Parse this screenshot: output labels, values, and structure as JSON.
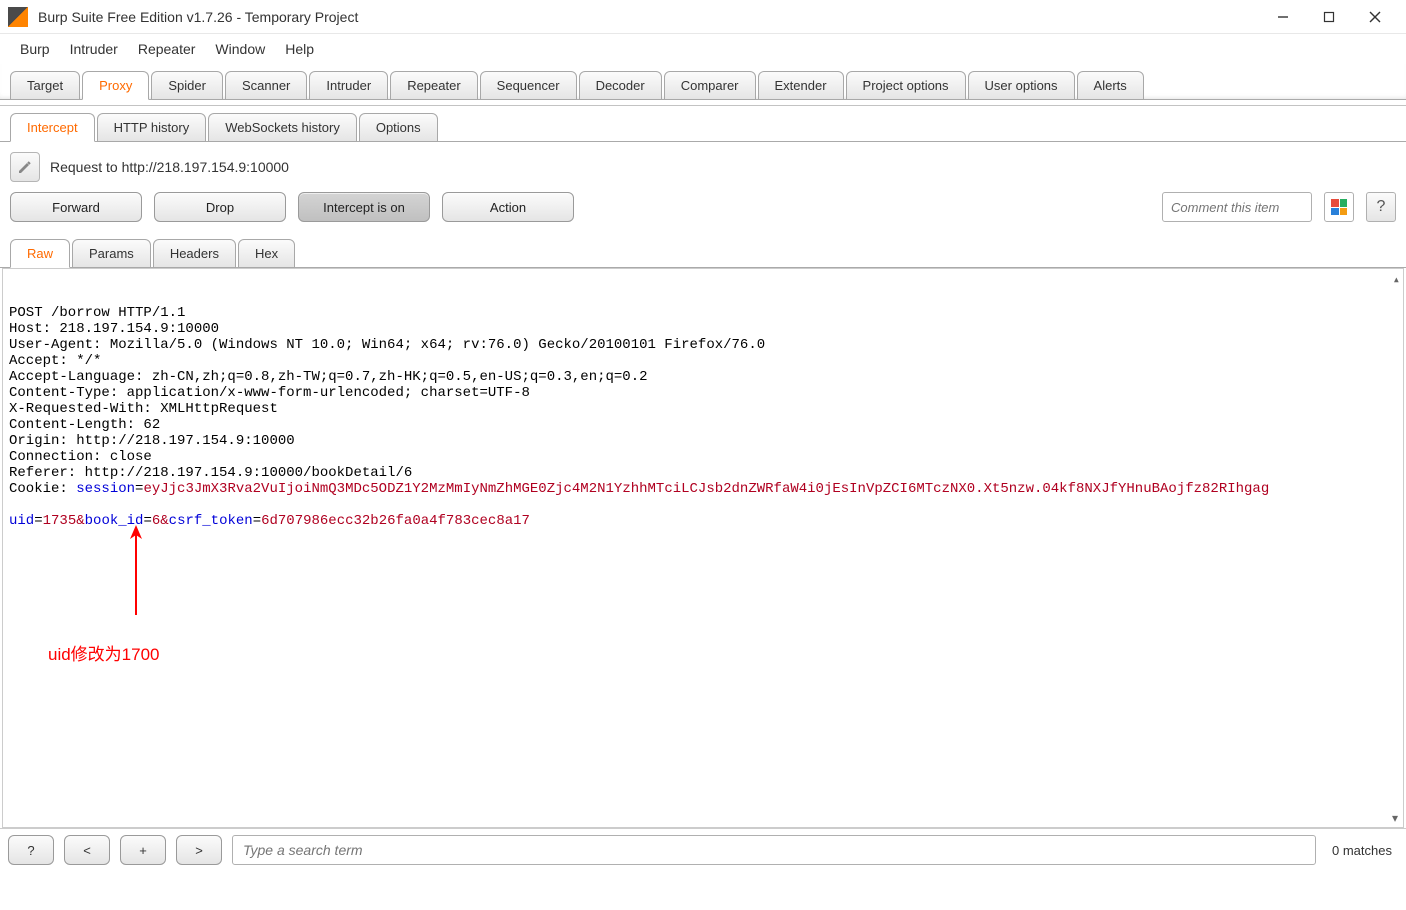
{
  "window": {
    "title": "Burp Suite Free Edition v1.7.26 - Temporary Project"
  },
  "menu": {
    "items": [
      "Burp",
      "Intruder",
      "Repeater",
      "Window",
      "Help"
    ]
  },
  "main_tabs": [
    "Target",
    "Proxy",
    "Spider",
    "Scanner",
    "Intruder",
    "Repeater",
    "Sequencer",
    "Decoder",
    "Comparer",
    "Extender",
    "Project options",
    "User options",
    "Alerts"
  ],
  "main_tab_active": 1,
  "sub_tabs": [
    "Intercept",
    "HTTP history",
    "WebSockets history",
    "Options"
  ],
  "sub_tab_active": 0,
  "request_label": "Request to http://218.197.154.9:10000",
  "buttons": {
    "forward": "Forward",
    "drop": "Drop",
    "intercept": "Intercept is on",
    "action": "Action"
  },
  "comment_placeholder": "Comment this item",
  "editor_tabs": [
    "Raw",
    "Params",
    "Headers",
    "Hex"
  ],
  "editor_tab_active": 0,
  "http": {
    "request_line": "POST /borrow HTTP/1.1",
    "headers": {
      "Host": "218.197.154.9:10000",
      "User-Agent": "Mozilla/5.0 (Windows NT 10.0; Win64; x64; rv:76.0) Gecko/20100101 Firefox/76.0",
      "Accept": "*/*",
      "Accept-Language": "zh-CN,zh;q=0.8,zh-TW;q=0.7,zh-HK;q=0.5,en-US;q=0.3,en;q=0.2",
      "Content-Type": "application/x-www-form-urlencoded; charset=UTF-8",
      "X-Requested-With": "XMLHttpRequest",
      "Content-Length": "62",
      "Origin": "http://218.197.154.9:10000",
      "Connection": "close",
      "Referer": "http://218.197.154.9:10000/bookDetail/6"
    },
    "cookie": {
      "name": "session",
      "value": "eyJjc3JmX3Rva2VuIjoiNmQ3MDc5ODZ1Y2MzMmIyNmZhMGE0Zjc4M2N1YzhhMTciLCJsb2dnZWRfaW4i0jEsInVpZCI6MTczNX0.Xt5nzw.04kf8NXJfYHnuBAojfz82RIhgag"
    },
    "body": [
      {
        "key": "uid",
        "value": "1735"
      },
      {
        "key": "book_id",
        "value": "6"
      },
      {
        "key": "csrf_token",
        "value": "6d707986ecc32b26fa0a4f783cec8a17"
      }
    ]
  },
  "annotation": {
    "arrow": "↑",
    "text": "uid修改为1700"
  },
  "search": {
    "placeholder": "Type a search term",
    "help": "?",
    "prev": "<",
    "plus": "+",
    "next": ">"
  },
  "matches": "0 matches"
}
